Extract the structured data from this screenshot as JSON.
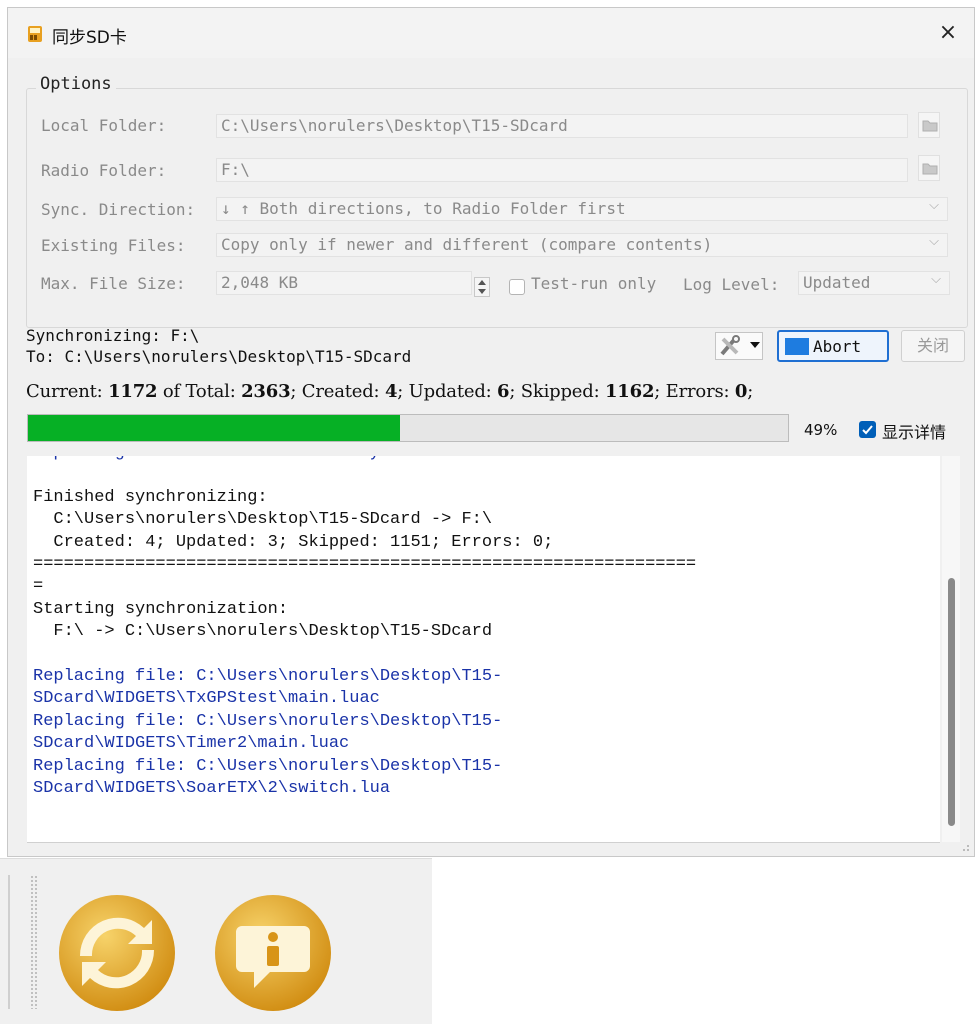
{
  "window": {
    "title": "同步SD卡",
    "close_glyph": "×"
  },
  "options": {
    "group_title": "Options",
    "local_folder": {
      "label": "Local Folder:",
      "value": "C:\\Users\\norulers\\Desktop\\T15-SDcard"
    },
    "radio_folder": {
      "label": "Radio Folder:",
      "value": "F:\\"
    },
    "sync_direction": {
      "label": "Sync. Direction:",
      "value": "↓ ↑  Both directions, to Radio Folder first"
    },
    "existing_files": {
      "label": "Existing Files:",
      "value": "Copy only if newer and different (compare contents)"
    },
    "max_file_size": {
      "label": "Max. File Size:",
      "value": "2,048 KB"
    },
    "test_run": {
      "label": "Test-run only",
      "checked": false
    },
    "log_level": {
      "label": "Log Level:",
      "value": "Updated"
    }
  },
  "status": {
    "line1": "Synchronizing: F:\\",
    "line2": "   To: C:\\Users\\norulers\\Desktop\\T15-SDcard"
  },
  "buttons": {
    "abort": "Abort",
    "close": "关闭"
  },
  "stats": {
    "current_label": "Current:",
    "current": "1172",
    "total_label": "of Total:",
    "total": "2363",
    "created_label": "; Created:",
    "created": "4",
    "updated_label": "; Updated:",
    "updated": "6",
    "skipped_label": "; Skipped:",
    "skipped": "1162",
    "errors_label": "; Errors:",
    "errors": "0",
    "end": ";"
  },
  "progress": {
    "value": 0.49,
    "label": "49%"
  },
  "show_details": {
    "label": "显示详情",
    "checked": true
  },
  "log_lines": [
    {
      "text": "Replacing file: F:\\MODELS\\labels.yml",
      "style": "blue"
    },
    {
      "text": "",
      "style": "black"
    },
    {
      "text": "Finished synchronizing:",
      "style": "black"
    },
    {
      "text": "  C:\\Users\\norulers\\Desktop\\T15-SDcard -> F:\\",
      "style": "black"
    },
    {
      "text": "  Created: 4; Updated: 3; Skipped: 1151; Errors: 0;",
      "style": "black"
    },
    {
      "text": "=================================================================",
      "style": "black"
    },
    {
      "text": "=",
      "style": "black"
    },
    {
      "text": "Starting synchronization:",
      "style": "black"
    },
    {
      "text": "  F:\\ -> C:\\Users\\norulers\\Desktop\\T15-SDcard",
      "style": "black"
    },
    {
      "text": "",
      "style": "black"
    },
    {
      "text": "Replacing file: C:\\Users\\norulers\\Desktop\\T15-",
      "style": "blue"
    },
    {
      "text": "SDcard\\WIDGETS\\TxGPStest\\main.luac",
      "style": "blue"
    },
    {
      "text": "Replacing file: C:\\Users\\norulers\\Desktop\\T15-",
      "style": "blue"
    },
    {
      "text": "SDcard\\WIDGETS\\Timer2\\main.luac",
      "style": "blue"
    },
    {
      "text": "Replacing file: C:\\Users\\norulers\\Desktop\\T15-",
      "style": "blue"
    },
    {
      "text": "SDcard\\WIDGETS\\SoarETX\\2\\switch.lua",
      "style": "blue"
    }
  ],
  "toolbar": {
    "items": [
      {
        "icon": "sync-icon",
        "color": "#e7a51f"
      },
      {
        "icon": "info-icon",
        "color": "#e7a51f"
      }
    ]
  }
}
